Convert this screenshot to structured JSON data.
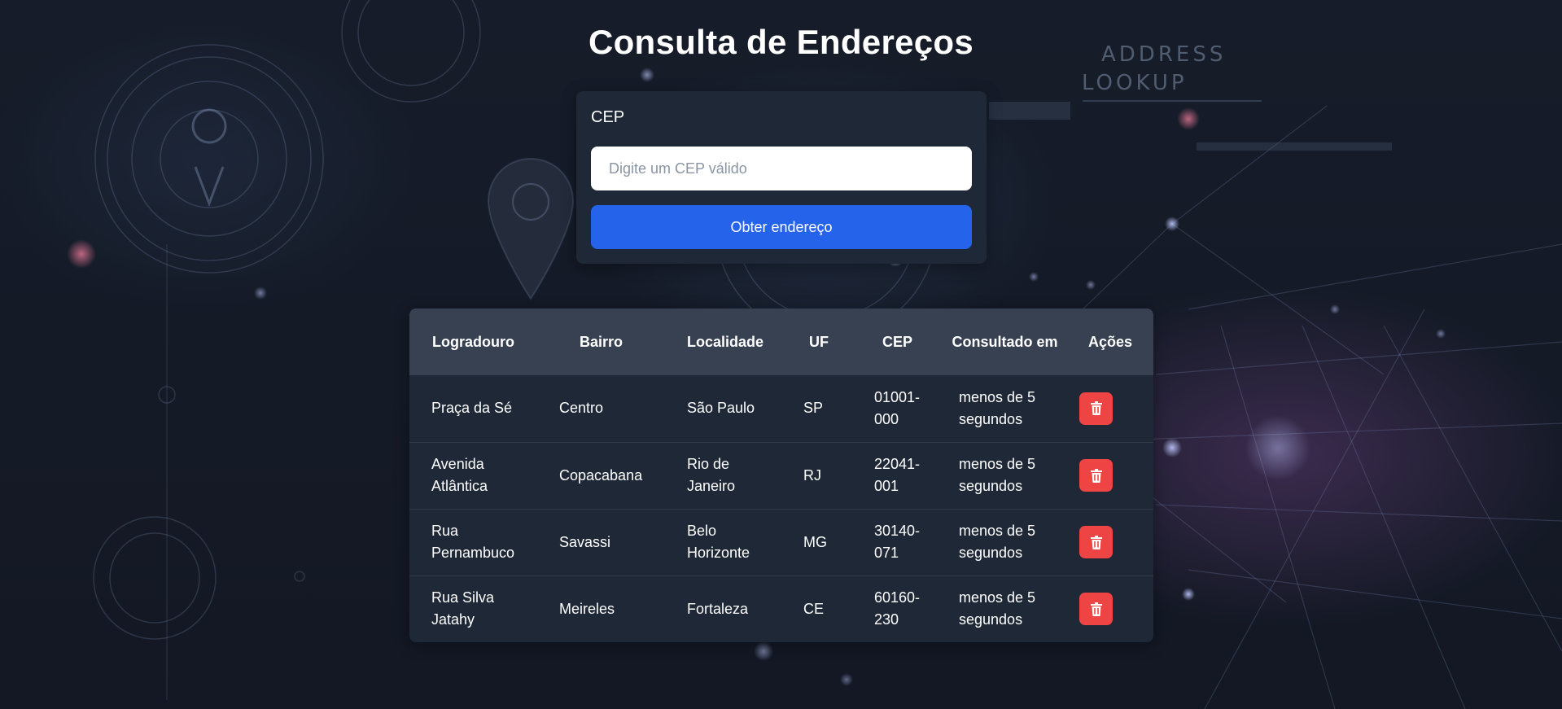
{
  "page": {
    "title": "Consulta de Endereços",
    "background_text": [
      "ADDRESS",
      "LOOKUP"
    ]
  },
  "form": {
    "label": "CEP",
    "input_value": "",
    "input_placeholder": "Digite um CEP válido",
    "button_label": "Obter endereço"
  },
  "table": {
    "headers": [
      "Logradouro",
      "Bairro",
      "Localidade",
      "UF",
      "CEP",
      "Consultado em",
      "Ações"
    ],
    "rows": [
      {
        "logradouro": "Praça da Sé",
        "bairro": "Centro",
        "localidade": "São Paulo",
        "uf": "SP",
        "cep": "01001-000",
        "consultado": "menos de 5 segundos"
      },
      {
        "logradouro": "Avenida Atlântica",
        "bairro": "Copacabana",
        "localidade": "Rio de Janeiro",
        "uf": "RJ",
        "cep": "22041-001",
        "consultado": "menos de 5 segundos"
      },
      {
        "logradouro": "Rua Pernambuco",
        "bairro": "Savassi",
        "localidade": "Belo Horizonte",
        "uf": "MG",
        "cep": "30140-071",
        "consultado": "menos de 5 segundos"
      },
      {
        "logradouro": "Rua Silva Jatahy",
        "bairro": "Meireles",
        "localidade": "Fortaleza",
        "uf": "CE",
        "cep": "60160-230",
        "consultado": "menos de 5 segundos"
      }
    ],
    "delete_icon": "trash-icon"
  },
  "colors": {
    "background": "#151b27",
    "card": "#1f2837",
    "table_header": "#374151",
    "primary_button": "#2563eb",
    "delete_button": "#ef4444"
  }
}
